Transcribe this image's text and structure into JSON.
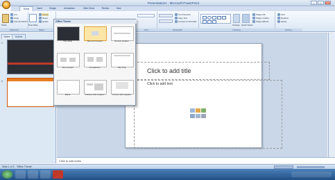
{
  "app": {
    "title": "Presentation1 - Microsoft PowerPoint",
    "controls": {
      "minimize": "–",
      "maximize": "□",
      "close": "×"
    }
  },
  "ribbon": {
    "tabs": [
      "Home",
      "Insert",
      "Design",
      "Animations",
      "Slide Show",
      "Review",
      "View"
    ],
    "active_tab": "Home",
    "groups": {
      "clipboard": {
        "label": "Clipboard",
        "paste": "Paste",
        "cut": "Cut",
        "copy": "Copy",
        "format_painter": "Format Painter"
      },
      "slides": {
        "label": "Slides",
        "new_slide": "New Slide",
        "layout": "Layout",
        "reset": "Reset",
        "delete": "Delete"
      },
      "font": {
        "label": "Font"
      },
      "paragraph": {
        "label": "Paragraph",
        "text_direction": "Text Direction",
        "align_text": "Align Text",
        "smartart": "Convert to SmartArt"
      },
      "drawing": {
        "label": "Drawing",
        "arrange": "Arrange",
        "quick_styles": "Quick Styles",
        "shape_fill": "Shape Fill",
        "shape_outline": "Shape Outline",
        "shape_effects": "Shape Effects"
      },
      "editing": {
        "label": "Editing",
        "find": "Find",
        "replace": "Replace",
        "select": "Select"
      }
    }
  },
  "layout_gallery": {
    "header": "Office Theme",
    "layouts": [
      "Title Slide",
      "Title and Content",
      "Section Header",
      "Two Content",
      "Comparison",
      "Title Only",
      "Blank",
      "Content with Caption",
      "Picture with Caption"
    ],
    "selected": "Title and Content"
  },
  "panel": {
    "tabs": [
      "Slides",
      "Outline"
    ],
    "slides": [
      "1",
      "2"
    ]
  },
  "slide": {
    "title_placeholder": "Click to add title",
    "body_placeholder": "Click to add text"
  },
  "notes": {
    "placeholder": "Click to add notes"
  },
  "statusbar": {
    "slide_info": "Slide 1 of 2",
    "theme": "\"Office Theme\""
  },
  "colors": {
    "accent": "#2a5d9f",
    "selected_layout": "#fbe6a8"
  }
}
